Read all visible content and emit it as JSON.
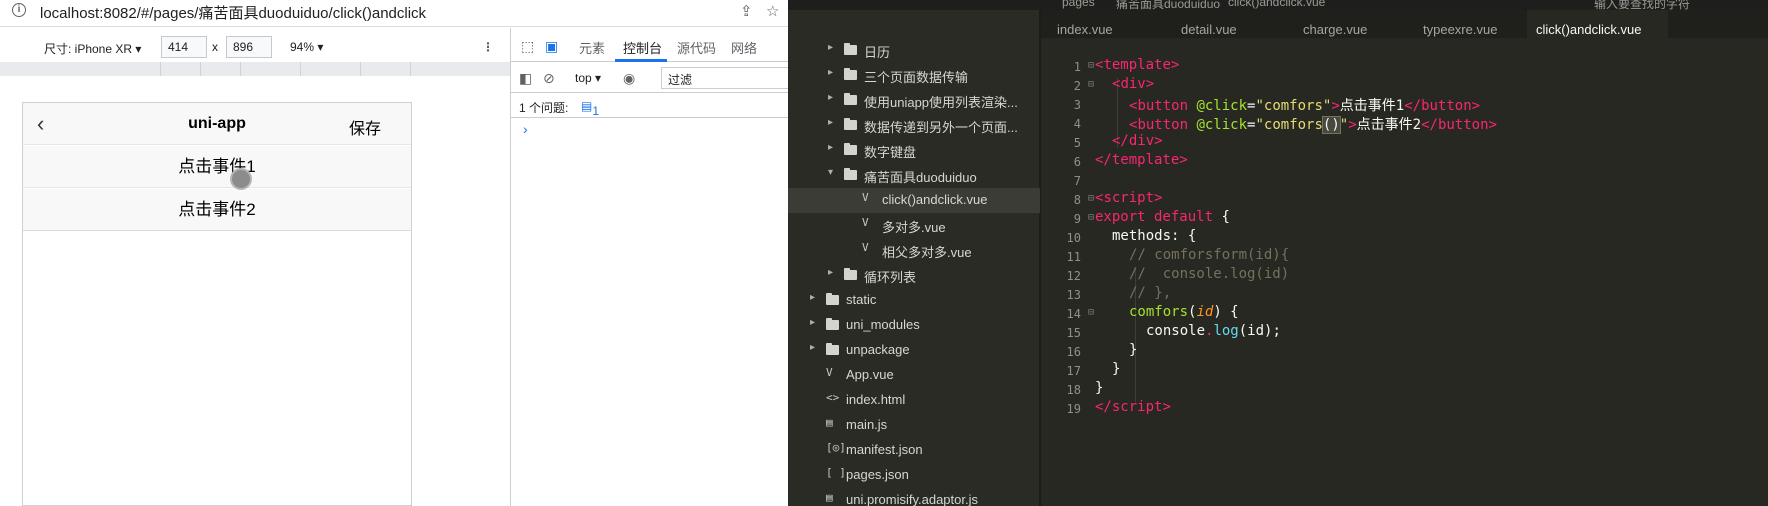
{
  "browser": {
    "url": "localhost:8082/#/pages/痛苦面具duoduiduo/click()andclick",
    "device_toolbar": {
      "size_label": "尺寸: iPhone XR",
      "width": "414",
      "times": "x",
      "height": "896",
      "zoom": "94%"
    }
  },
  "app": {
    "title": "uni-app",
    "back_icon": "chevron-left-icon",
    "save_label": "保存",
    "button1": "点击事件1",
    "button2": "点击事件2"
  },
  "devtools": {
    "tabs": [
      "元素",
      "控制台",
      "源代码",
      "网络"
    ],
    "active_tab": "控制台",
    "context": "top",
    "filter_placeholder": "过滤",
    "issues_label": "1 个问题:",
    "issues_count": "1",
    "prompt": "›",
    "accent": "#1a73e8"
  },
  "editor": {
    "breadcrumb": [
      "pages",
      "痛苦面具duoduiduo",
      "click()andclick.vue"
    ],
    "search_hint": "输入要查找的字符",
    "tabs": [
      "index.vue",
      "detail.vue",
      "charge.vue",
      "typeexre.vue",
      "click()andclick.vue"
    ],
    "active_tab": "click()andclick.vue",
    "tree": [
      {
        "label": "日历",
        "type": "folder"
      },
      {
        "label": "三个页面数据传输",
        "type": "folder"
      },
      {
        "label": "使用uniapp使用列表渲染...",
        "type": "folder"
      },
      {
        "label": "数据传递到另外一个页面...",
        "type": "folder"
      },
      {
        "label": "数字键盘",
        "type": "folder"
      },
      {
        "label": "痛苦面具duoduiduo",
        "type": "folder-open"
      },
      {
        "label": "click()andclick.vue",
        "type": "vue",
        "selected": true
      },
      {
        "label": "多对多.vue",
        "type": "vue"
      },
      {
        "label": "相父多对多.vue",
        "type": "vue"
      },
      {
        "label": "循环列表",
        "type": "folder"
      },
      {
        "label": "static",
        "type": "folder"
      },
      {
        "label": "uni_modules",
        "type": "folder"
      },
      {
        "label": "unpackage",
        "type": "folder"
      },
      {
        "label": "App.vue",
        "type": "vue"
      },
      {
        "label": "index.html",
        "type": "html"
      },
      {
        "label": "main.js",
        "type": "js"
      },
      {
        "label": "manifest.json",
        "type": "json-config"
      },
      {
        "label": "pages.json",
        "type": "json"
      },
      {
        "label": "uni.promisify.adaptor.js",
        "type": "js"
      }
    ],
    "line_numbers": [
      "1",
      "2",
      "3",
      "4",
      "5",
      "6",
      "7",
      "8",
      "9",
      "10",
      "11",
      "12",
      "13",
      "14",
      "15",
      "16",
      "17",
      "18",
      "19"
    ],
    "code": {
      "l1_open": "<",
      "l1_tag": "template",
      "l1_close": ">",
      "l2_open": "<",
      "l2_tag": "div",
      "l2_close": ">",
      "l3_open": "<",
      "l3_tag": "button",
      "l3_attr": " @click",
      "l3_eq": "=",
      "l3_val": "\"comfors\"",
      "l3_gt": ">",
      "l3_text": "点击事件1",
      "l3_end_open": "</",
      "l3_end_tag": "button",
      "l3_end_close": ">",
      "l4_open": "<",
      "l4_tag": "button",
      "l4_attr": " @click",
      "l4_eq": "=",
      "l4_q": "\"",
      "l4_fn": "comfors",
      "l4_paren": "()",
      "l4_q2": "\"",
      "l4_gt": ">",
      "l4_text": "点击事件2",
      "l4_end_open": "</",
      "l4_end_tag": "button",
      "l4_end_close": ">",
      "l5_open": "</",
      "l5_tag": "div",
      "l5_close": ">",
      "l6_open": "</",
      "l6_tag": "template",
      "l6_close": ">",
      "l8_open": "<",
      "l8_tag": "script",
      "l8_close": ">",
      "l9_kw": "export default",
      "l9_rest": " {",
      "l10": "methods: {",
      "l11": "// comforsform(id){",
      "l12": "//  console.log(id)",
      "l13": "// },",
      "l14_fn": "comfors",
      "l14_p1": "(",
      "l14_param": "id",
      "l14_p2": ") {",
      "l15_a": "console",
      "l15_dot": ".",
      "l15_m": "log",
      "l15_b": "(id);",
      "l16": "}",
      "l17": "}",
      "l18": "}",
      "l19_open": "</",
      "l19_tag": "script",
      "l19_close": ">"
    }
  }
}
